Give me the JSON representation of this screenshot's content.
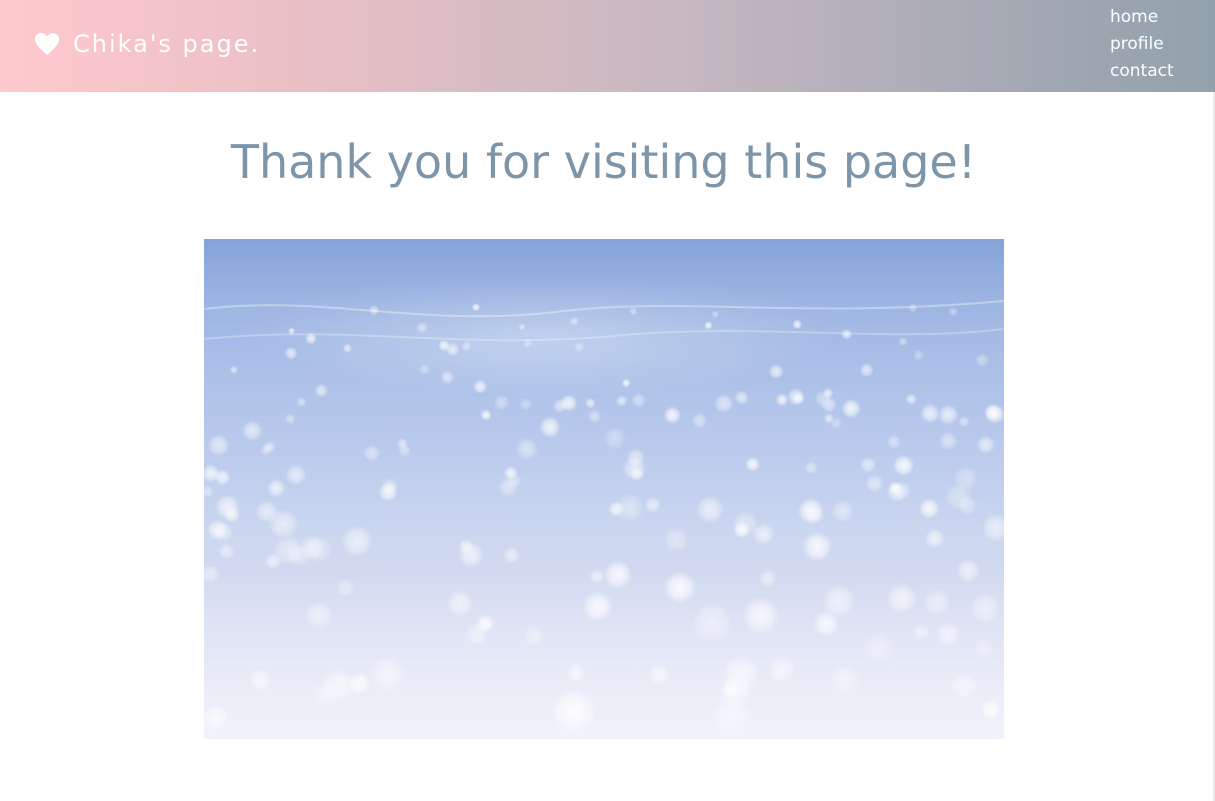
{
  "header": {
    "brand": {
      "icon": "heart-icon",
      "label": "Chika's page."
    },
    "nav": {
      "items": [
        {
          "label": "home"
        },
        {
          "label": "profile"
        },
        {
          "label": "contact"
        }
      ]
    },
    "colors": {
      "gradient_start": "#ffc9cd",
      "gradient_end": "#92a1ab",
      "text": "#ffffff"
    }
  },
  "main": {
    "title": "Thank you for visiting this page!",
    "title_color": "#7d95a9",
    "image": {
      "subject": "sparkling sea water bokeh"
    }
  }
}
